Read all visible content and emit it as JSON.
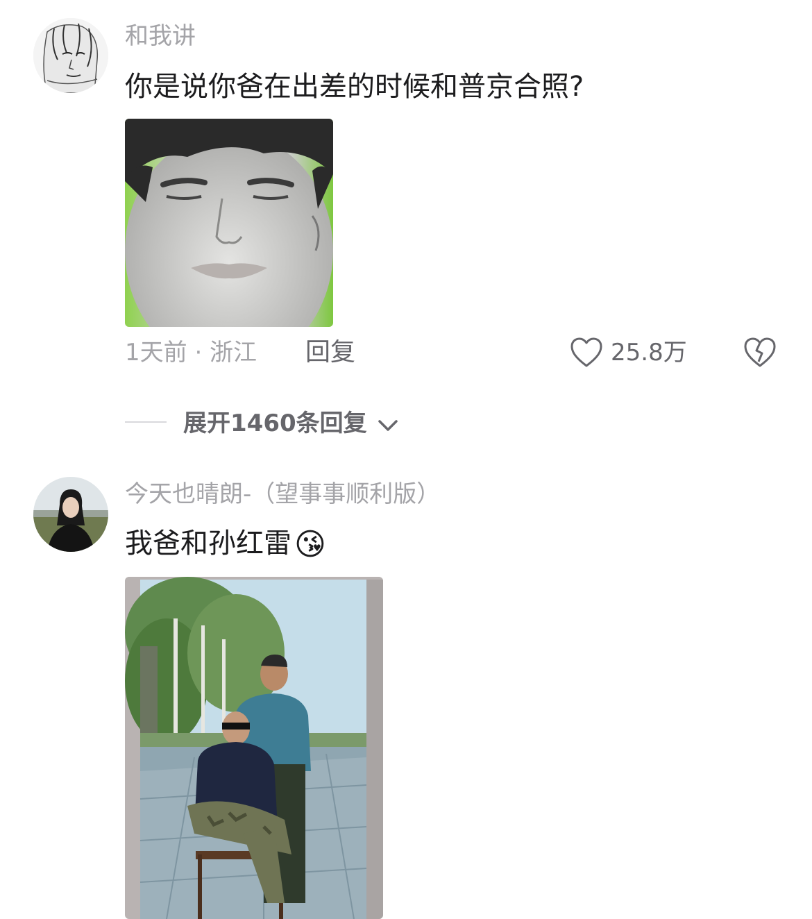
{
  "comments": [
    {
      "username": "和我讲",
      "text": "你是说你爸在出差的时候和普京合照?",
      "time_location": "1天前 · 浙江",
      "reply_label": "回复",
      "likes": "25.8万"
    },
    {
      "username": "今天也晴朗-（望事事顺利版）",
      "text": "我爸和孙红雷",
      "emoji": "😘"
    }
  ],
  "expand_replies_label": "展开1460条回复",
  "colors": {
    "meta_gray": "#a4a4a8",
    "text_dark": "#1c1c1e",
    "action_gray": "#66666b"
  }
}
